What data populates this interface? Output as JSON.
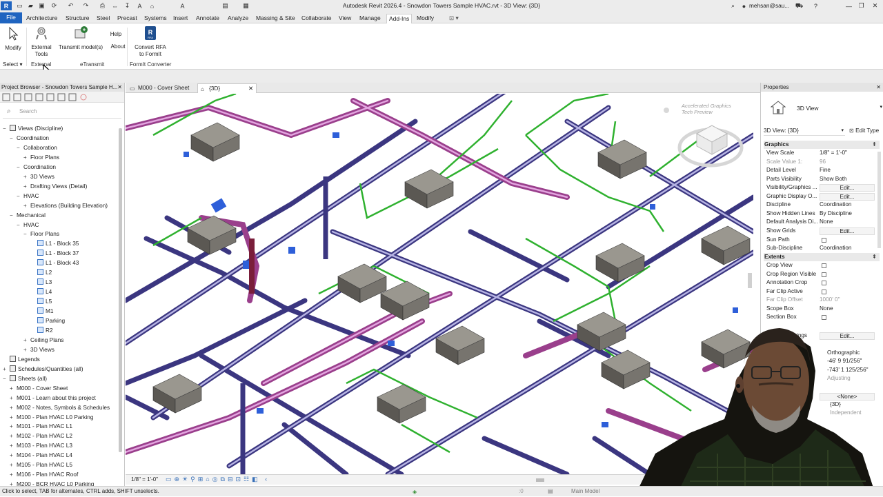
{
  "app": {
    "title": "Autodesk Revit 2026.4 - Snowdon Towers Sample HVAC.rvt - 3D View: {3D}",
    "user": "mehsan@sau...",
    "ribbon_tabs": [
      "File",
      "Architecture",
      "Structure",
      "Steel",
      "Precast",
      "Systems",
      "Insert",
      "Annotate",
      "Analyze",
      "Massing & Site",
      "Collaborate",
      "View",
      "Manage",
      "Add-Ins",
      "Modify"
    ],
    "active_tab": "Add-Ins"
  },
  "ribbon": {
    "modify": "Modify",
    "select": "Select",
    "external_tools_1": "External",
    "external_tools_2": "Tools",
    "external_panel": "External",
    "transmit": "Transmit model(s)",
    "etransmit_panel": "eTransmit",
    "help": "Help",
    "about": "About",
    "convert_1": "Convert RFA",
    "convert_2": "to FormIt",
    "formit_panel": "FormIt Converter"
  },
  "browser": {
    "title": "Project Browser - Snowdon Towers Sample H...",
    "search_placeholder": "Search",
    "items": [
      {
        "label": "Views (Discipline)",
        "indent": 0,
        "tw": "−",
        "type": "root"
      },
      {
        "label": "Coordination",
        "indent": 1,
        "tw": "−"
      },
      {
        "label": "Collaboration",
        "indent": 2,
        "tw": "−"
      },
      {
        "label": "Floor Plans",
        "indent": 3,
        "tw": "+"
      },
      {
        "label": "Coordination",
        "indent": 2,
        "tw": "−"
      },
      {
        "label": "3D Views",
        "indent": 3,
        "tw": "+"
      },
      {
        "label": "Drafting Views (Detail)",
        "indent": 3,
        "tw": "+"
      },
      {
        "label": "HVAC",
        "indent": 2,
        "tw": "−"
      },
      {
        "label": "Elevations (Building Elevation)",
        "indent": 3,
        "tw": "+"
      },
      {
        "label": "Mechanical",
        "indent": 1,
        "tw": "−"
      },
      {
        "label": "HVAC",
        "indent": 2,
        "tw": "−"
      },
      {
        "label": "Floor Plans",
        "indent": 3,
        "tw": "−"
      },
      {
        "label": "L1 - Block 35",
        "indent": 4,
        "tw": "",
        "type": "view"
      },
      {
        "label": "L1 - Block 37",
        "indent": 4,
        "tw": "",
        "type": "view"
      },
      {
        "label": "L1 - Block 43",
        "indent": 4,
        "tw": "",
        "type": "view"
      },
      {
        "label": "L2",
        "indent": 4,
        "tw": "",
        "type": "view"
      },
      {
        "label": "L3",
        "indent": 4,
        "tw": "",
        "type": "view"
      },
      {
        "label": "L4",
        "indent": 4,
        "tw": "",
        "type": "view"
      },
      {
        "label": "L5",
        "indent": 4,
        "tw": "",
        "type": "view"
      },
      {
        "label": "M1",
        "indent": 4,
        "tw": "",
        "type": "view"
      },
      {
        "label": "Parking",
        "indent": 4,
        "tw": "",
        "type": "view"
      },
      {
        "label": "R2",
        "indent": 4,
        "tw": "",
        "type": "view"
      },
      {
        "label": "Ceiling Plans",
        "indent": 3,
        "tw": "+"
      },
      {
        "label": "3D Views",
        "indent": 3,
        "tw": "+"
      },
      {
        "label": "Legends",
        "indent": 0,
        "tw": "",
        "type": "root"
      },
      {
        "label": "Schedules/Quantities (all)",
        "indent": 0,
        "tw": "+",
        "type": "root"
      },
      {
        "label": "Sheets (all)",
        "indent": 0,
        "tw": "−",
        "type": "root"
      },
      {
        "label": "M000 - Cover Sheet",
        "indent": 1,
        "tw": "+"
      },
      {
        "label": "M001 - Learn about this project",
        "indent": 1,
        "tw": "+"
      },
      {
        "label": "M002 - Notes, Symbols & Schedules",
        "indent": 1,
        "tw": "+"
      },
      {
        "label": "M100 - Plan HVAC L0 Parking",
        "indent": 1,
        "tw": "+"
      },
      {
        "label": "M101 - Plan HVAC L1",
        "indent": 1,
        "tw": "+"
      },
      {
        "label": "M102 - Plan HVAC L2",
        "indent": 1,
        "tw": "+"
      },
      {
        "label": "M103 - Plan HVAC L3",
        "indent": 1,
        "tw": "+"
      },
      {
        "label": "M104 - Plan HVAC L4",
        "indent": 1,
        "tw": "+"
      },
      {
        "label": "M105 - Plan HVAC L5",
        "indent": 1,
        "tw": "+"
      },
      {
        "label": "M106 - Plan HVAC Roof",
        "indent": 1,
        "tw": "+"
      },
      {
        "label": "M200 - BCR HVAC L0 Parking",
        "indent": 1,
        "tw": "+"
      }
    ]
  },
  "viewtabs": {
    "tab1": "M000 - Cover Sheet",
    "tab2": "{3D}"
  },
  "canvas": {
    "preview_1": "Accelerated Graphics",
    "preview_2": "Tech Preview"
  },
  "viewbar": {
    "scale": "1/8\" = 1'-0\""
  },
  "properties": {
    "title": "Properties",
    "type_name": "3D View",
    "selector": "3D View: {3D}",
    "edit_type": "Edit Type",
    "graphics_group": "Graphics",
    "extents_group": "Extents",
    "rows": [
      {
        "k": "View Scale",
        "v": "1/8\" = 1'-0\""
      },
      {
        "k": "Scale Value    1:",
        "v": "96",
        "dim": true
      },
      {
        "k": "Detail Level",
        "v": "Fine"
      },
      {
        "k": "Parts Visibility",
        "v": "Show Both"
      },
      {
        "k": "Visibility/Graphics ...",
        "v": "Edit...",
        "btn": true
      },
      {
        "k": "Graphic Display O...",
        "v": "Edit...",
        "btn": true
      },
      {
        "k": "Discipline",
        "v": "Coordination"
      },
      {
        "k": "Show Hidden Lines",
        "v": "By Discipline"
      },
      {
        "k": "Default Analysis Di...",
        "v": "None"
      },
      {
        "k": "Show Grids",
        "v": "Edit...",
        "btn": true
      },
      {
        "k": "Sun Path",
        "v": "",
        "cb": true
      },
      {
        "k": "Sub-Discipline",
        "v": "Coordination"
      }
    ],
    "extent_rows": [
      {
        "k": "Crop View",
        "v": "",
        "cb": true
      },
      {
        "k": "Crop Region Visible",
        "v": "",
        "cb": true
      },
      {
        "k": "Annotation Crop",
        "v": "",
        "cb": true
      },
      {
        "k": "Far Clip Active",
        "v": "",
        "cb": true
      },
      {
        "k": "Far Clip Offset",
        "v": "1000'  0\"",
        "dim": true
      },
      {
        "k": "Scope Box",
        "v": "None"
      },
      {
        "k": "Section Box",
        "v": "",
        "cb": true
      }
    ],
    "camera_edit": "Edit...",
    "camera_partial": "ings",
    "projection": "Orthographic",
    "eye_elev": "-46'  9 91/256\"",
    "target_elev": "-743'  1 125/256\"",
    "adjusting": "Adjusting",
    "none_value": "<None>",
    "phase_value": "{3D}",
    "independent": "Independent"
  },
  "status": {
    "text": "Click to select, TAB for alternates, CTRL adds, SHIFT unselects.",
    "workset_count": ":0",
    "model": "Main Model"
  }
}
